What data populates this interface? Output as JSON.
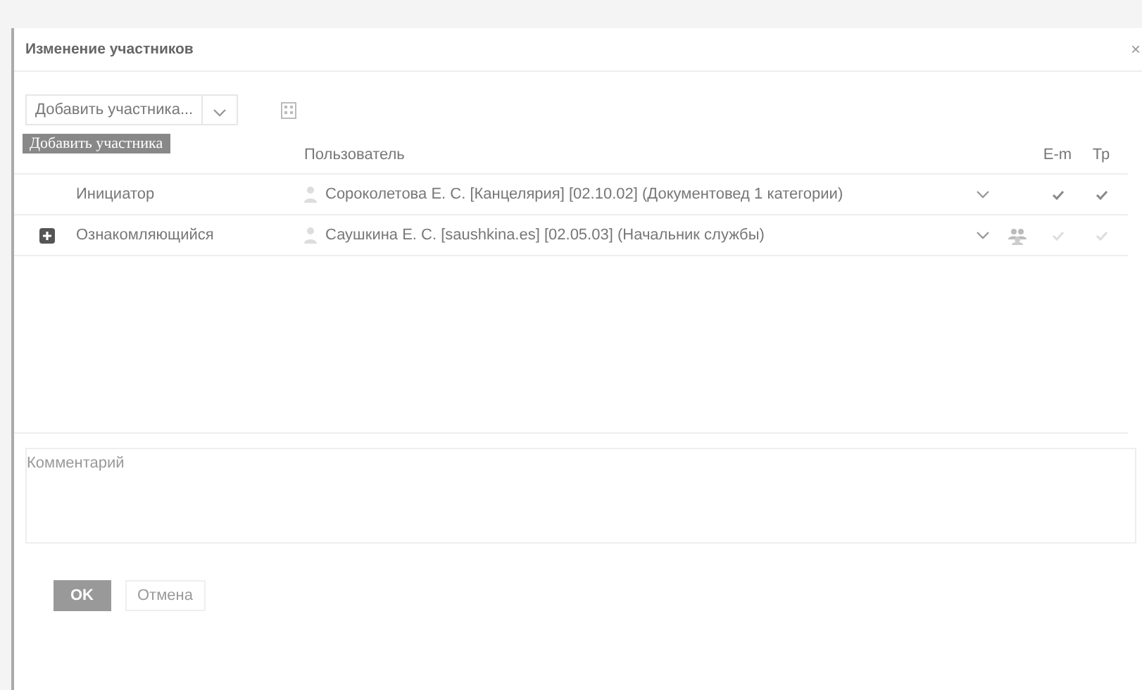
{
  "window": {
    "title": "Изменение участников",
    "close": "×"
  },
  "toolbar": {
    "add_button": "Добавить участника...",
    "tooltip": "Добавить участника"
  },
  "table": {
    "columns": [
      "Пользователь",
      "E-m",
      "Тр"
    ],
    "rows": [
      {
        "role": "Инициатор",
        "expandable": false,
        "user": "Сороколетова Е. С. [Канцелярия] [02.10.02] (Документовед 1 категории)",
        "has_group": false,
        "email_checked": true,
        "tr_checked": true,
        "checks_disabled": false
      },
      {
        "role": "Ознакомляющийся",
        "expandable": true,
        "user": "Саушкина Е. С. [saushkina.es] [02.05.03] (Начальник службы)",
        "has_group": true,
        "email_checked": true,
        "tr_checked": true,
        "checks_disabled": true
      }
    ]
  },
  "comment": {
    "placeholder": "Комментарий"
  },
  "buttons": {
    "ok": "OK",
    "cancel": "Отмена"
  }
}
